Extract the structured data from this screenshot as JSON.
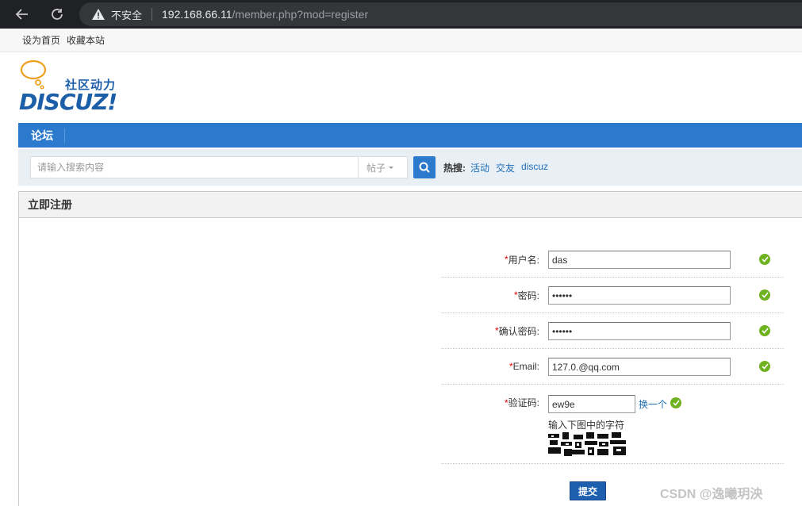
{
  "browser": {
    "security_label": "不安全",
    "url_host": "192.168.66.11",
    "url_path": "/member.php?mod=register"
  },
  "toplinks": {
    "set_home": "设为首页",
    "bookmark": "收藏本站"
  },
  "logo": {
    "sub": "社区动力",
    "main": "DISCUZ!"
  },
  "nav": {
    "forum": "论坛"
  },
  "search": {
    "placeholder": "请输入搜索内容",
    "type": "帖子",
    "hot_label": "热搜:",
    "hot_items": [
      "活动",
      "交友",
      "discuz"
    ]
  },
  "panel": {
    "title": "立即注册"
  },
  "form": {
    "username": {
      "label": "用户名:",
      "value": "das"
    },
    "password": {
      "label": "密码:",
      "value": "••••••"
    },
    "confirm": {
      "label": "确认密码:",
      "value": "••••••"
    },
    "email": {
      "label": "Email:",
      "value": "127.0.@qq.com"
    },
    "captcha": {
      "label": "验证码:",
      "value": "ew9e",
      "change": "换一个",
      "hint": "输入下图中的字符"
    },
    "required_mark": "*",
    "submit": "提交"
  },
  "watermark": "CSDN @逸曦玥泱",
  "colors": {
    "accent": "#2b7acd",
    "ok": "#6fb21f",
    "required": "#e00000"
  }
}
